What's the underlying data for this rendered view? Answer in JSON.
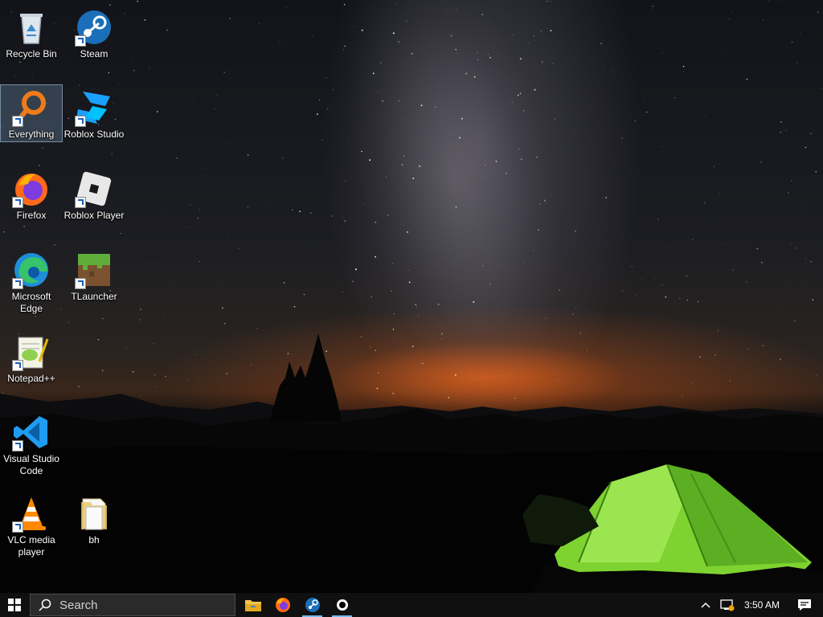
{
  "desktop": {
    "icons": [
      {
        "label": "Recycle Bin",
        "icon": "recycle-bin-icon"
      },
      {
        "label": "Steam",
        "icon": "steam-icon"
      },
      {
        "label": "Everything",
        "icon": "everything-search-icon"
      },
      {
        "label": "Roblox Studio",
        "icon": "roblox-studio-icon"
      },
      {
        "label": "Firefox",
        "icon": "firefox-icon"
      },
      {
        "label": "Roblox Player",
        "icon": "roblox-player-icon"
      },
      {
        "label": "Microsoft Edge",
        "icon": "edge-icon"
      },
      {
        "label": "TLauncher",
        "icon": "tlauncher-icon"
      },
      {
        "label": "Notepad++",
        "icon": "notepad-plus-plus-icon"
      },
      {
        "label": "Visual Studio Code",
        "icon": "vscode-icon"
      },
      {
        "label": "VLC media player",
        "icon": "vlc-icon"
      },
      {
        "label": "bh",
        "icon": "folder-icon"
      }
    ]
  },
  "taskbar": {
    "search_placeholder": "Search",
    "pinned": [
      {
        "name": "File Explorer",
        "icon": "file-explorer-icon"
      },
      {
        "name": "Firefox",
        "icon": "firefox-icon"
      },
      {
        "name": "Steam",
        "icon": "steam-icon"
      },
      {
        "name": "App",
        "icon": "black-circle-app-icon"
      }
    ],
    "clock": "3:50 AM"
  },
  "colors": {
    "taskbar_bg": "#101010",
    "running_indicator": "#76b9ed",
    "tent_green": "#8ee040"
  }
}
